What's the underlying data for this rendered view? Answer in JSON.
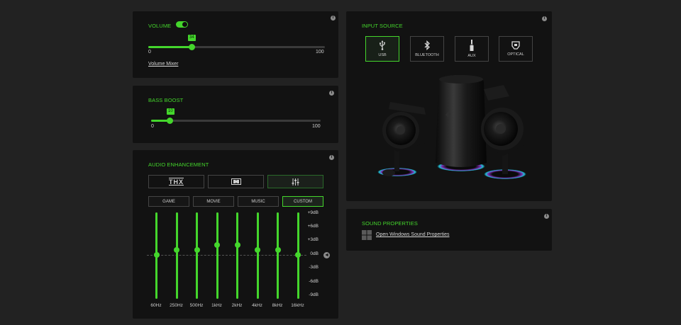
{
  "volume": {
    "title": "VOLUME",
    "enabled": true,
    "value": 34,
    "min_label": "0",
    "max_label": "100",
    "mixer_link": "Volume Mixer"
  },
  "bass": {
    "title": "BASS BOOST",
    "value": 10,
    "min_label": "0",
    "max_label": "100"
  },
  "enhancement": {
    "title": "AUDIO ENHANCEMENT",
    "modes": [
      {
        "icon": "thx-icon",
        "text": "THX",
        "active": false
      },
      {
        "icon": "dolby-icon",
        "active": false
      },
      {
        "icon": "equalizer-icon",
        "active": true
      }
    ],
    "presets": [
      {
        "label": "GAME",
        "active": false
      },
      {
        "label": "MOVIE",
        "active": false
      },
      {
        "label": "MUSIC",
        "active": false
      },
      {
        "label": "CUSTOM",
        "active": true
      }
    ],
    "db_labels": [
      "+9dB",
      "+6dB",
      "+3dB",
      "0dB",
      "-3dB",
      "-6dB",
      "-9dB"
    ],
    "bands": [
      {
        "label": "60Hz",
        "db": 0
      },
      {
        "label": "250Hz",
        "db": 1
      },
      {
        "label": "500Hz",
        "db": 1
      },
      {
        "label": "1kHz",
        "db": 2
      },
      {
        "label": "2kHz",
        "db": 2
      },
      {
        "label": "4kHz",
        "db": 1
      },
      {
        "label": "8kHz",
        "db": 1
      },
      {
        "label": "16kHz",
        "db": 0
      }
    ]
  },
  "input": {
    "title": "INPUT SOURCE",
    "sources": [
      {
        "label": "USB",
        "icon": "usb-icon",
        "active": true
      },
      {
        "label": "BLUETOOTH",
        "icon": "bluetooth-icon",
        "active": false
      },
      {
        "label": "AUX",
        "icon": "aux-icon",
        "active": false
      },
      {
        "label": "OPTICAL",
        "icon": "optical-icon",
        "active": false
      }
    ],
    "image_icon": "speaker-system-image"
  },
  "sound_props": {
    "title": "SOUND PROPERTIES",
    "link": "Open Windows Sound Properties",
    "icon": "windows-logo-icon"
  },
  "colors": {
    "accent": "#44d62c",
    "panel": "#121212",
    "background": "#222222"
  }
}
